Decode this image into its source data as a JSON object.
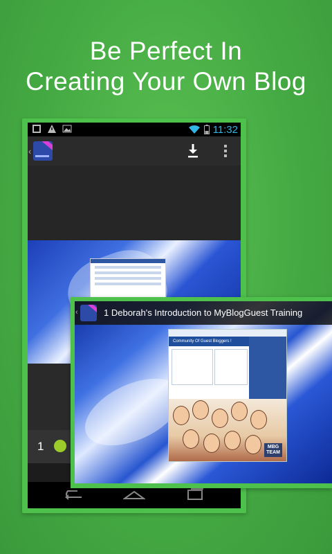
{
  "headline": {
    "line1": "Be Perfect In",
    "line2": "Creating Your Own Blog"
  },
  "phone1": {
    "status_time": "11:32",
    "list_first_number": "1"
  },
  "phone2": {
    "title": "1  Deborah's Introduction to MyBlogGuest Training",
    "thumbnail_heading": "Community Of Guest Bloggers !",
    "team_label_1": "MBG",
    "team_label_2": "TEAM"
  },
  "colors": {
    "background_green": "#4dc14b",
    "time_blue": "#33b5e5",
    "app_blue": "#2d4aa8"
  }
}
